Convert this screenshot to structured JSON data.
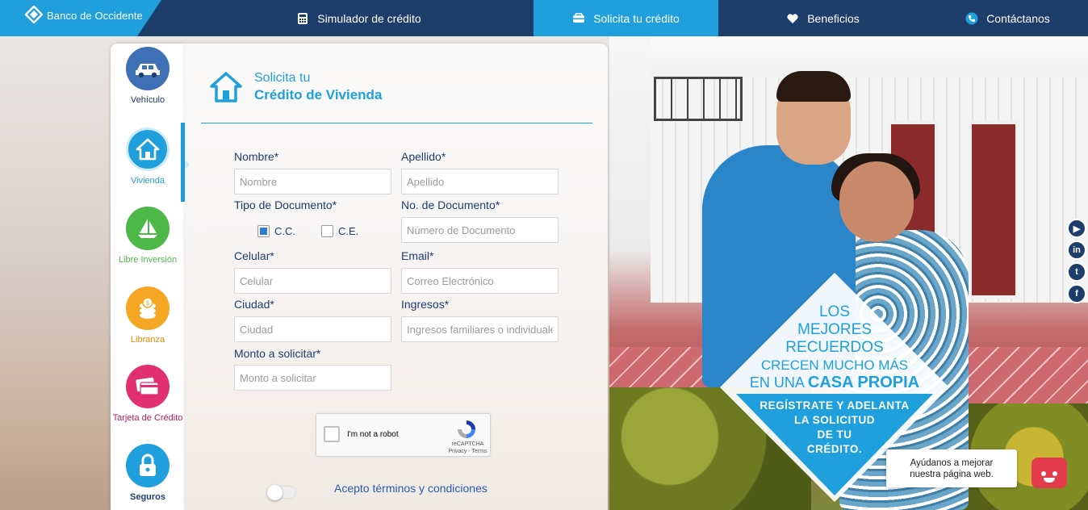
{
  "brand": {
    "name": "Banco de Occidente"
  },
  "nav": {
    "items": [
      {
        "label": "Simulador de crédito",
        "icon": "calculator-icon"
      },
      {
        "label": "Solicita tu crédito",
        "icon": "handshake-icon"
      },
      {
        "label": "Beneficios",
        "icon": "heart-icon"
      },
      {
        "label": "Contáctanos",
        "icon": "phone-icon"
      }
    ],
    "active": "Solicita tu crédito"
  },
  "sidebar": {
    "items": [
      {
        "label": "Vehículo",
        "icon": "car-icon",
        "color": "#3f6fb5",
        "labelColor": "#1d3d6b"
      },
      {
        "label": "Vivienda",
        "icon": "house-icon",
        "color": "#1fa0dd",
        "labelColor": "#1fa0dd"
      },
      {
        "label": "Libre Inversión",
        "icon": "sailboat-icon",
        "color": "#4db848",
        "labelColor": "#4db848"
      },
      {
        "label": "Libranza",
        "icon": "coins-icon",
        "color": "#f5a623",
        "labelColor": "#e38a00"
      },
      {
        "label": "Tarjeta de Crédito",
        "icon": "credit-card-icon",
        "color": "#e0306f",
        "labelColor": "#c2185b"
      },
      {
        "label": "Seguros",
        "icon": "lock-icon",
        "color": "#1fa0dd",
        "labelColor": "#1d3d6b"
      }
    ],
    "active": "Vivienda"
  },
  "form": {
    "title_line1": "Solicita tu",
    "title_line2": "Crédito de Vivienda",
    "nombre": {
      "label": "Nombre*",
      "placeholder": "Nombre",
      "value": ""
    },
    "apellido": {
      "label": "Apellido*",
      "placeholder": "Apellido",
      "value": ""
    },
    "tipo_documento": {
      "label": "Tipo de Documento*",
      "options": [
        "C.C.",
        "C.E."
      ],
      "selected": "C.C."
    },
    "no_documento": {
      "label": "No. de Documento*",
      "placeholder": "Número de Documento",
      "value": ""
    },
    "celular": {
      "label": "Celular*",
      "placeholder": "Celular",
      "value": ""
    },
    "email": {
      "label": "Email*",
      "placeholder": "Correo Electrónico",
      "value": ""
    },
    "ciudad": {
      "label": "Ciudad*",
      "placeholder": "Ciudad",
      "value": ""
    },
    "ingresos": {
      "label": "Ingresos*",
      "placeholder": "Ingresos familiares o individuales",
      "value": ""
    },
    "monto": {
      "label": "Monto a solicitar*",
      "placeholder": "Monto a solicitar",
      "value": ""
    },
    "recaptcha": {
      "label": "I'm not a robot",
      "brand": "reCAPTCHA",
      "links": "Privacy - Terms"
    },
    "terms": {
      "label": "Acepto términos y condiciones",
      "accepted": false
    }
  },
  "promo": {
    "line1": "LOS",
    "line2": "MEJORES",
    "line3": "RECUERDOS",
    "line4": "CRECEN MUCHO MÁS",
    "line5a": "EN UNA ",
    "line5b": "CASA PROPIA",
    "cta1": "REGÍSTRATE Y ADELANTA",
    "cta2": "LA SOLICITUD",
    "cta3": "DE TU",
    "cta4": "CRÉDITO."
  },
  "social": [
    {
      "name": "youtube-icon",
      "glyph": "▶"
    },
    {
      "name": "linkedin-icon",
      "glyph": "in"
    },
    {
      "name": "twitter-icon",
      "glyph": "t"
    },
    {
      "name": "facebook-icon",
      "glyph": "f"
    }
  ],
  "help": {
    "line1": "Ayúdanos a mejorar",
    "line2": "nuestra página web."
  },
  "colors": {
    "primary": "#1fa0dd",
    "navy": "#1d3d6b"
  }
}
